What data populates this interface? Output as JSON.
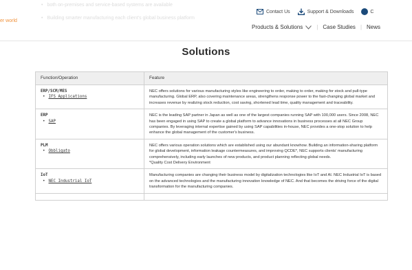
{
  "header": {
    "ghost_lines": [
      "both on-premises and service-based systems are available",
      "Building smarter manufacturing each client's global business platform"
    ],
    "brand_fragment": "er world",
    "utility_links": [
      {
        "label": "Contact Us",
        "icon": "mail-icon"
      },
      {
        "label": "Support & Downloads",
        "icon": "download-icon"
      },
      {
        "label": "C",
        "icon": "globe-icon"
      }
    ],
    "nav": [
      {
        "label": "Products & Solutions",
        "has_dropdown": true
      },
      {
        "label": "Case Studies",
        "has_dropdown": false
      },
      {
        "label": "News",
        "has_dropdown": false
      }
    ]
  },
  "page": {
    "title": "Solutions"
  },
  "table": {
    "headers": [
      "Function/Operation",
      "Feature"
    ],
    "rows": [
      {
        "function": "ERP/SCM/MES",
        "link": "IFS Applications",
        "feature": "NEC offers solutions for various manufacturing styles like engineering to order, making to order, making for stock and pull-type manufacturing. Global ERP, also covering maintenance areas, strengthens response power to the fast-changing global market and increases revenue by realizing stock reduction, cost saving, shortened lead time, quality management and traceability.",
        "note": ""
      },
      {
        "function": "ERP",
        "link": "SAP",
        "feature": "NEC is the leading SAP partner in Japan as well as one of the largest companies running SAP with 100,000 users. Since 2008, NEC has been engaged in using SAP to create a global platform to advance innovations in business processes at all NEC Group companies. By leveraging internal expertise gained by using SAP capabilities in-house, NEC provides a one-stop solution to help enhance the global management of the customer's business.",
        "note": ""
      },
      {
        "function": "PLM",
        "link": "Obbligato",
        "feature": "NEC offers various operation solutions which are established using our abundant knowhow. Building an information-sharing platform for global development, information leakage countermeasures, and improving QCDE*, NEC supports clients' manufacturing comprehensively, including early launches of new products, and product planning reflecting global needs.",
        "note": "*Quality Cost Delivery Environment"
      },
      {
        "function": "IoT",
        "link": "NEC Industrial IoT",
        "feature": "Manufacturing companies are changing their business model by digitalization technologies like IoT and AI. NEC Industrial IoT is based on the advanced technologies and the manufacturing innovation knowledge of NEC. And that becomes the driving force of the digital transformation for the manufacturing companies.",
        "note": ""
      }
    ]
  },
  "colors": {
    "accent": "#f0913a",
    "link_blue": "#1b4a7a",
    "header_bg": "#efefef",
    "border": "#cfcfcf"
  }
}
